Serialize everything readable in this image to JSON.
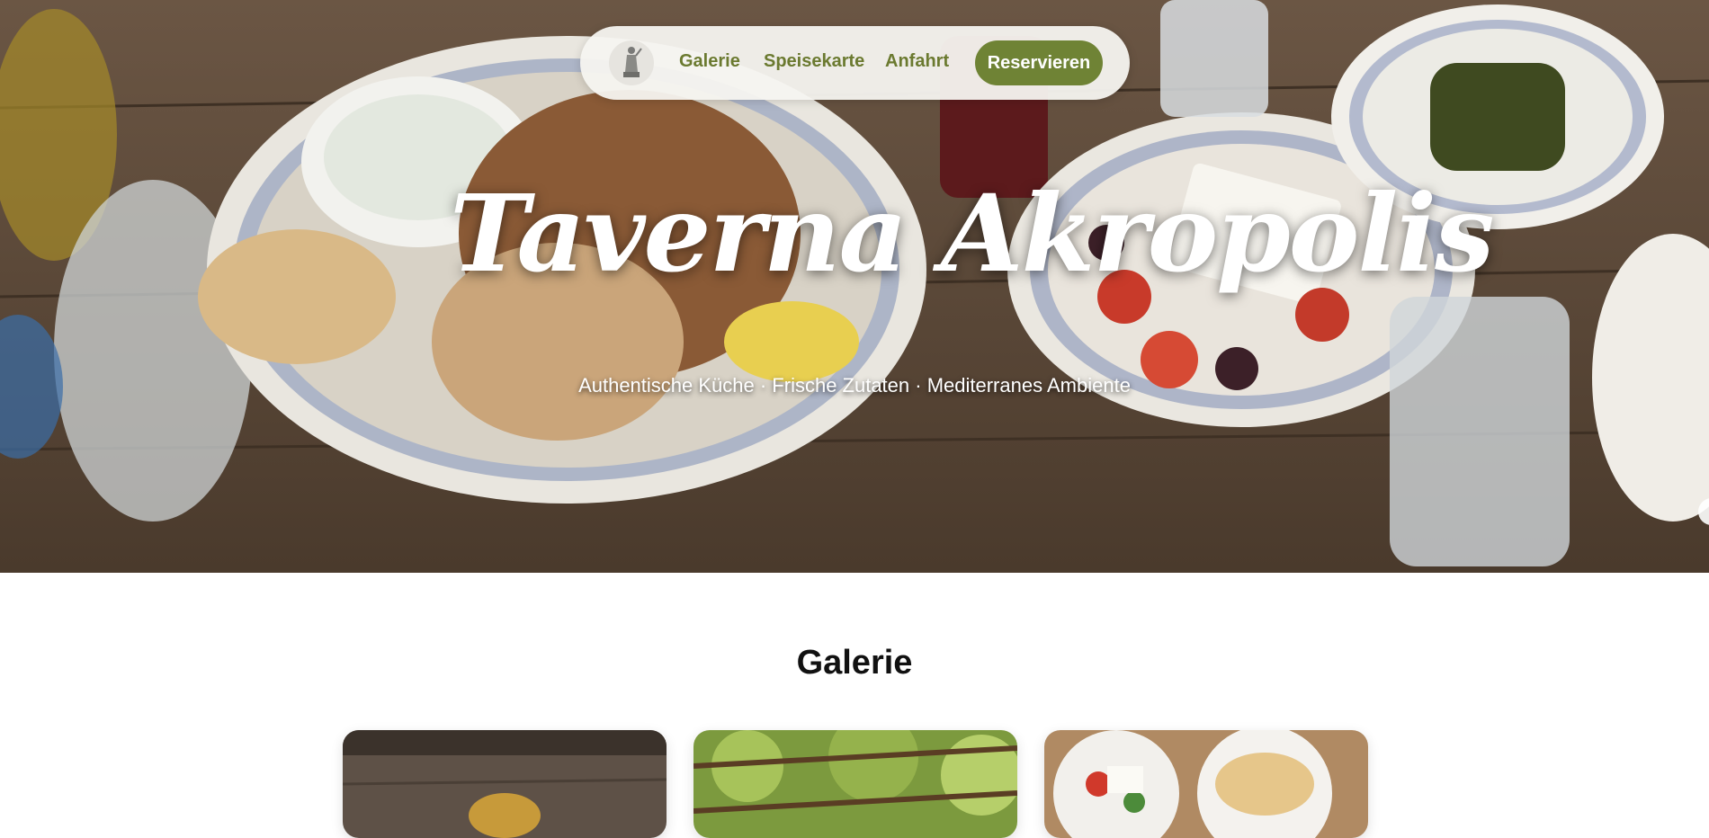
{
  "nav": {
    "logo_icon": "statue-logo-icon",
    "links": [
      {
        "label": "Galerie"
      },
      {
        "label": "Speisekarte"
      },
      {
        "label": "Anfahrt"
      }
    ],
    "reserve_label": "Reservieren"
  },
  "hero": {
    "title": "Taverna Akropolis",
    "subtitle": "Authentische Küche · Frische Zutaten · Mediterranes Ambiente",
    "image": "greek-food-table-image"
  },
  "galerie": {
    "title": "Galerie",
    "images": [
      "grill-food-photo",
      "pergola-vine-photo",
      "salad-pita-photo"
    ]
  },
  "colors": {
    "accent": "#6f8335",
    "nav_text": "#6b7a30",
    "nav_bg": "#f5f4f0"
  }
}
